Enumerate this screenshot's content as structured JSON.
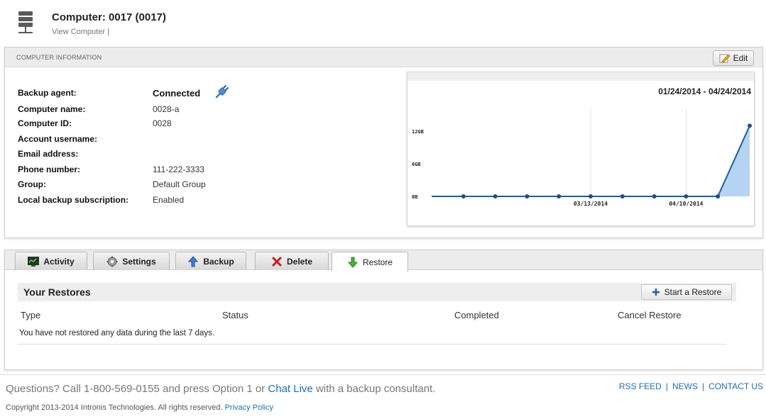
{
  "header": {
    "title": "Computer: 0017 (0017)",
    "breadcrumb": "View Computer |"
  },
  "info_panel": {
    "heading": "COMPUTER INFORMATION",
    "edit_label": "Edit",
    "rows": [
      {
        "label": "Backup agent:",
        "value": "Connected"
      },
      {
        "label": "Computer name:",
        "value": "0028-a"
      },
      {
        "label": "Computer ID:",
        "value": "0028"
      },
      {
        "label": "Account username:",
        "value": ""
      },
      {
        "label": "Email address:",
        "value": ""
      },
      {
        "label": "Phone number:",
        "value": "111-222-3333"
      },
      {
        "label": "Group:",
        "value": "Default Group"
      },
      {
        "label": "Local backup subscription:",
        "value": "Enabled"
      }
    ]
  },
  "chart_data": {
    "type": "area",
    "title": "01/24/2014 - 04/24/2014",
    "xlabel": "",
    "ylabel": "",
    "y_ticks": [
      "0B",
      "6GB",
      "12GB"
    ],
    "x_ticks": [
      "03/13/2014",
      "04/10/2014"
    ],
    "ylim": [
      0,
      15
    ],
    "x": [
      "01/24/2014",
      "02/01/2014",
      "02/13/2014",
      "02/21/2014",
      "03/01/2014",
      "03/13/2014",
      "03/21/2014",
      "04/01/2014",
      "04/10/2014",
      "04/17/2014",
      "04/24/2014"
    ],
    "series": [
      {
        "values": [
          0,
          0,
          0,
          0,
          0,
          0,
          0,
          0,
          0,
          0,
          13
        ]
      }
    ],
    "grid": "vertical",
    "color": "#1a5ea8"
  },
  "tabs": [
    {
      "label": "Activity",
      "icon": "monitor-icon"
    },
    {
      "label": "Settings",
      "icon": "gear-icon"
    },
    {
      "label": "Backup",
      "icon": "up-arrow-icon"
    },
    {
      "label": "Delete",
      "icon": "x-icon"
    },
    {
      "label": "Restore",
      "icon": "down-arrow-icon"
    }
  ],
  "restores": {
    "title": "Your Restores",
    "start_label": "Start a Restore",
    "columns": [
      "Type",
      "Status",
      "Completed",
      "Cancel Restore"
    ],
    "empty_message": "You have not restored any data during the last 7 days."
  },
  "footer": {
    "questions_prefix": "Questions? Call 1-800-569-0155 and press Option 1 or",
    "chat_link": "Chat Live",
    "questions_suffix": "with a backup consultant.",
    "links": [
      "RSS FEED",
      "NEWS",
      "CONTACT US"
    ],
    "copyright": "Copyright 2013-2014 Intronis Technologies. All rights reserved.",
    "privacy_link": "Privacy Policy"
  }
}
